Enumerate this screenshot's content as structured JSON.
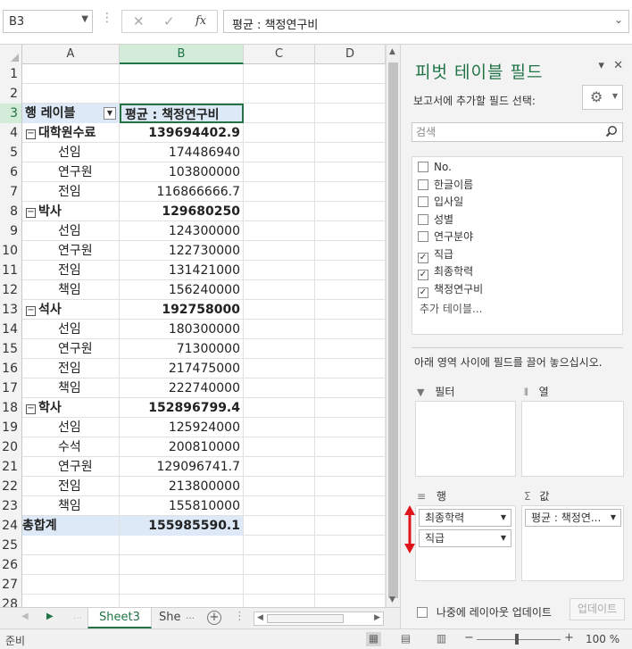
{
  "formula_bar": {
    "name_box": "B3",
    "fx_label": "fx",
    "cancel_glyph": "✕",
    "enter_glyph": "✓",
    "content": "평균 : 책정연구비"
  },
  "columns": [
    "A",
    "B",
    "C",
    "D"
  ],
  "rows": [
    {
      "n": "1",
      "a": "",
      "b": ""
    },
    {
      "n": "2",
      "a": "",
      "b": ""
    },
    {
      "n": "3",
      "a": "행 레이블",
      "b": "평균 : 책정연구비"
    },
    {
      "n": "4",
      "a": "대학원수료",
      "b": "139694402.9"
    },
    {
      "n": "5",
      "a": "선임",
      "b": "174486940"
    },
    {
      "n": "6",
      "a": "연구원",
      "b": "103800000"
    },
    {
      "n": "7",
      "a": "전임",
      "b": "116866666.7"
    },
    {
      "n": "8",
      "a": "박사",
      "b": "129680250"
    },
    {
      "n": "9",
      "a": "선임",
      "b": "124300000"
    },
    {
      "n": "10",
      "a": "연구원",
      "b": "122730000"
    },
    {
      "n": "11",
      "a": "전임",
      "b": "131421000"
    },
    {
      "n": "12",
      "a": "책임",
      "b": "156240000"
    },
    {
      "n": "13",
      "a": "석사",
      "b": "192758000"
    },
    {
      "n": "14",
      "a": "선임",
      "b": "180300000"
    },
    {
      "n": "15",
      "a": "연구원",
      "b": "71300000"
    },
    {
      "n": "16",
      "a": "전임",
      "b": "217475000"
    },
    {
      "n": "17",
      "a": "책임",
      "b": "222740000"
    },
    {
      "n": "18",
      "a": "학사",
      "b": "152896799.4"
    },
    {
      "n": "19",
      "a": "선임",
      "b": "125924000"
    },
    {
      "n": "20",
      "a": "수석",
      "b": "200810000"
    },
    {
      "n": "21",
      "a": "연구원",
      "b": "129096741.7"
    },
    {
      "n": "22",
      "a": "전임",
      "b": "213800000"
    },
    {
      "n": "23",
      "a": "책임",
      "b": "155810000"
    },
    {
      "n": "24",
      "a": "총합계",
      "b": "155985590.1"
    },
    {
      "n": "25",
      "a": "",
      "b": ""
    },
    {
      "n": "26",
      "a": "",
      "b": ""
    },
    {
      "n": "27",
      "a": "",
      "b": ""
    },
    {
      "n": "28",
      "a": "",
      "b": ""
    }
  ],
  "sheet_tabs": {
    "active": "Sheet3",
    "other": "She",
    "add": "+"
  },
  "pivot_pane": {
    "title": "피벗 테이블 필드",
    "choose_label": "보고서에 추가할 필드 선택:",
    "search_placeholder": "검색",
    "fields": [
      {
        "name": "No.",
        "checked": false
      },
      {
        "name": "한글이름",
        "checked": false
      },
      {
        "name": "입사일",
        "checked": false
      },
      {
        "name": "성별",
        "checked": false
      },
      {
        "name": "연구분야",
        "checked": false
      },
      {
        "name": "직급",
        "checked": true
      },
      {
        "name": "최종학력",
        "checked": true
      },
      {
        "name": "책정연구비",
        "checked": true
      }
    ],
    "more_tables": "추가 테이블...",
    "drag_hint": "아래 영역 사이에 필드를 끌어 놓으십시오.",
    "areas": {
      "filters": "필터",
      "columns": "열",
      "rows": "행",
      "values": "값"
    },
    "row_fields": [
      "최종학력",
      "직급"
    ],
    "value_fields": [
      "평균 : 책정연..."
    ],
    "defer_label": "나중에 레이아웃 업데이트",
    "update_button": "업데이트"
  },
  "status_bar": {
    "mode": "준비",
    "zoom": "100 %"
  },
  "colors": {
    "excel_green": "#217346",
    "pivot_header_fill": "#dde9f6",
    "annotation_arrow": "#e0151b"
  }
}
